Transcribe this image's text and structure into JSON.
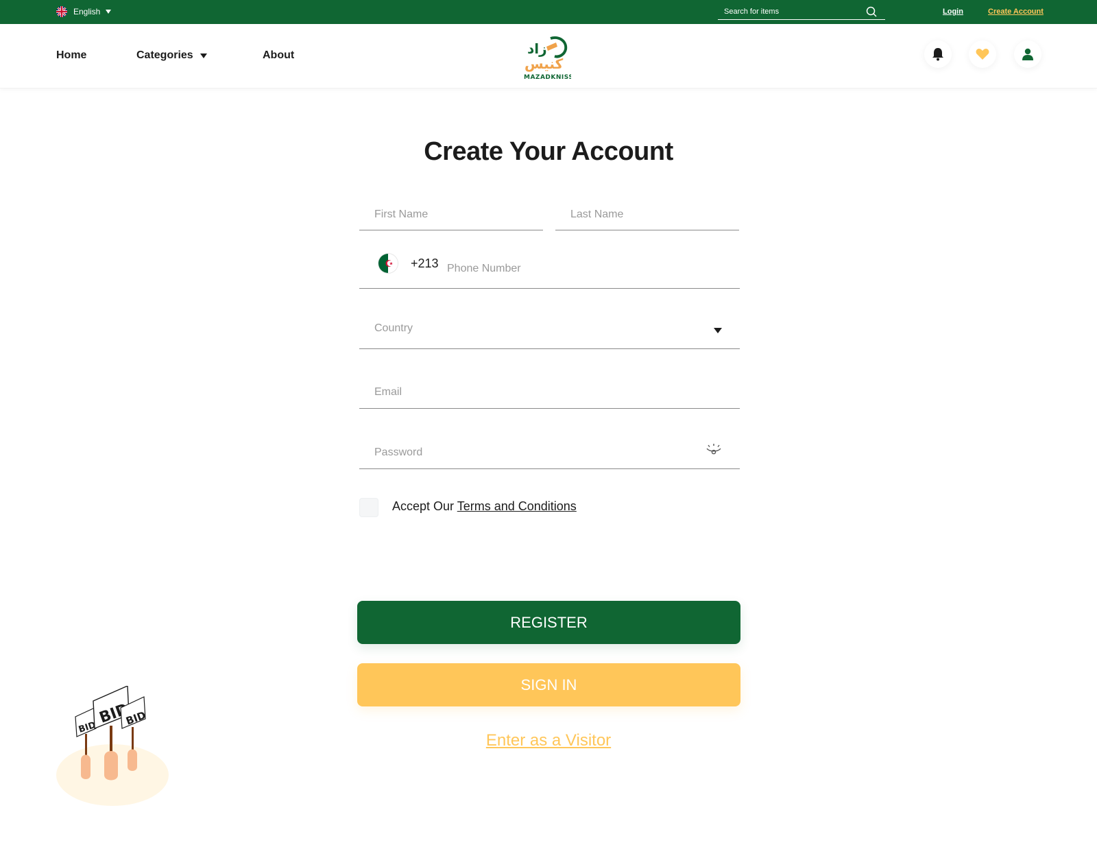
{
  "topbar": {
    "language": "English",
    "search_placeholder": "Search for items",
    "login": "Login",
    "create_account": "Create Account"
  },
  "nav": {
    "home": "Home",
    "categories": "Categories",
    "about": "About"
  },
  "logo": {
    "arabic_top": "زاد",
    "arabic_bottom": "كنيس",
    "latin": "MAZADKNISS"
  },
  "form": {
    "title": "Create Your Account",
    "first_name_placeholder": "First Name",
    "last_name_placeholder": "Last Name",
    "dial_code": "+213",
    "phone_placeholder": "Phone Number",
    "country_placeholder": "Country",
    "email_placeholder": "Email",
    "password_placeholder": "Password",
    "accept_prefix": "Accept Our ",
    "terms_link": "Terms and Conditions",
    "register_label": "REGISTER",
    "signin_label": "SIGN IN",
    "visitor_label": "Enter as a Visitor"
  },
  "illustration": {
    "sign_text": "BID"
  },
  "colors": {
    "brand_green": "#106633",
    "accent_yellow": "#ffc659"
  }
}
